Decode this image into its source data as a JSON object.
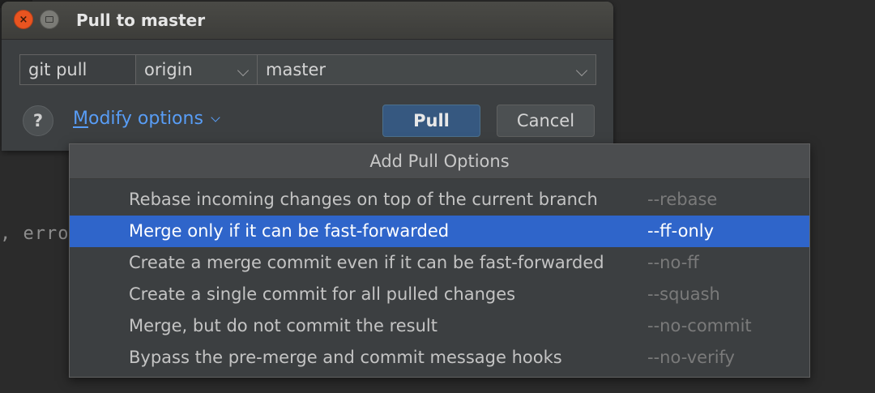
{
  "background": {
    "code_fragment": ", erro"
  },
  "dialog": {
    "title": "Pull to master",
    "window_controls": {
      "close_glyph": "×",
      "maximize_icon": "maximize-icon"
    },
    "command": "git pull",
    "remote": {
      "value": "origin"
    },
    "branch": {
      "value": "master"
    },
    "help_label": "?",
    "modify_options_label": "Modify options",
    "pull_button": "Pull",
    "cancel_button": "Cancel"
  },
  "popup": {
    "header": "Add Pull Options",
    "options": [
      {
        "label": "Rebase incoming changes on top of the current branch",
        "flag": "--rebase",
        "selected": false
      },
      {
        "label": "Merge only if it can be fast-forwarded",
        "flag": "--ff-only",
        "selected": true
      },
      {
        "label": "Create a merge commit even if it can be fast-forwarded",
        "flag": "--no-ff",
        "selected": false
      },
      {
        "label": "Create a single commit for all pulled changes",
        "flag": "--squash",
        "selected": false
      },
      {
        "label": "Merge, but do not commit the result",
        "flag": "--no-commit",
        "selected": false
      },
      {
        "label": "Bypass the pre-merge and commit message hooks",
        "flag": "--no-verify",
        "selected": false
      }
    ]
  },
  "colors": {
    "accent": "#589df6",
    "selection": "#2f65ca",
    "primary_button": "#365880",
    "close_button": "#e95420"
  }
}
